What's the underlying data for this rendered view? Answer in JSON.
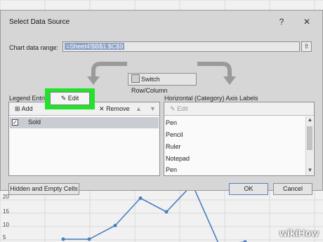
{
  "dialog": {
    "title": "Select Data Source",
    "help_glyph": "?",
    "close_glyph": "✕",
    "chart_range_label": "Chart data range:",
    "chart_range_value": "=Sheet4!$B$1:$C$9",
    "collapse_glyph": "⇧",
    "switch_label": "Switch Row/Column",
    "legend_label": "Legend Entries (Series)",
    "axis_label": "Horizontal (Category) Axis Labels",
    "legend_toolbar": {
      "add": "Add",
      "edit": "Edit",
      "remove": "Remove",
      "up": "▲",
      "down": "▼"
    },
    "series": [
      {
        "name": "Sold",
        "checked": true
      }
    ],
    "axis_toolbar": {
      "edit": "Edit"
    },
    "axis_items": [
      "Pen",
      "Pencil",
      "Ruler",
      "Notepad",
      "Pen"
    ],
    "hidden_cells_label": "Hidden and Empty Cells",
    "ok_label": "OK",
    "cancel_label": "Cancel",
    "highlight_color": "#22e22b"
  },
  "background_chart": {
    "y_ticks": [
      "20",
      "15",
      "10",
      "5"
    ],
    "line_color": "#4a7ec2",
    "values": [
      5,
      5,
      10,
      20,
      15,
      25,
      3,
      4
    ]
  },
  "watermark": "wikiHow"
}
